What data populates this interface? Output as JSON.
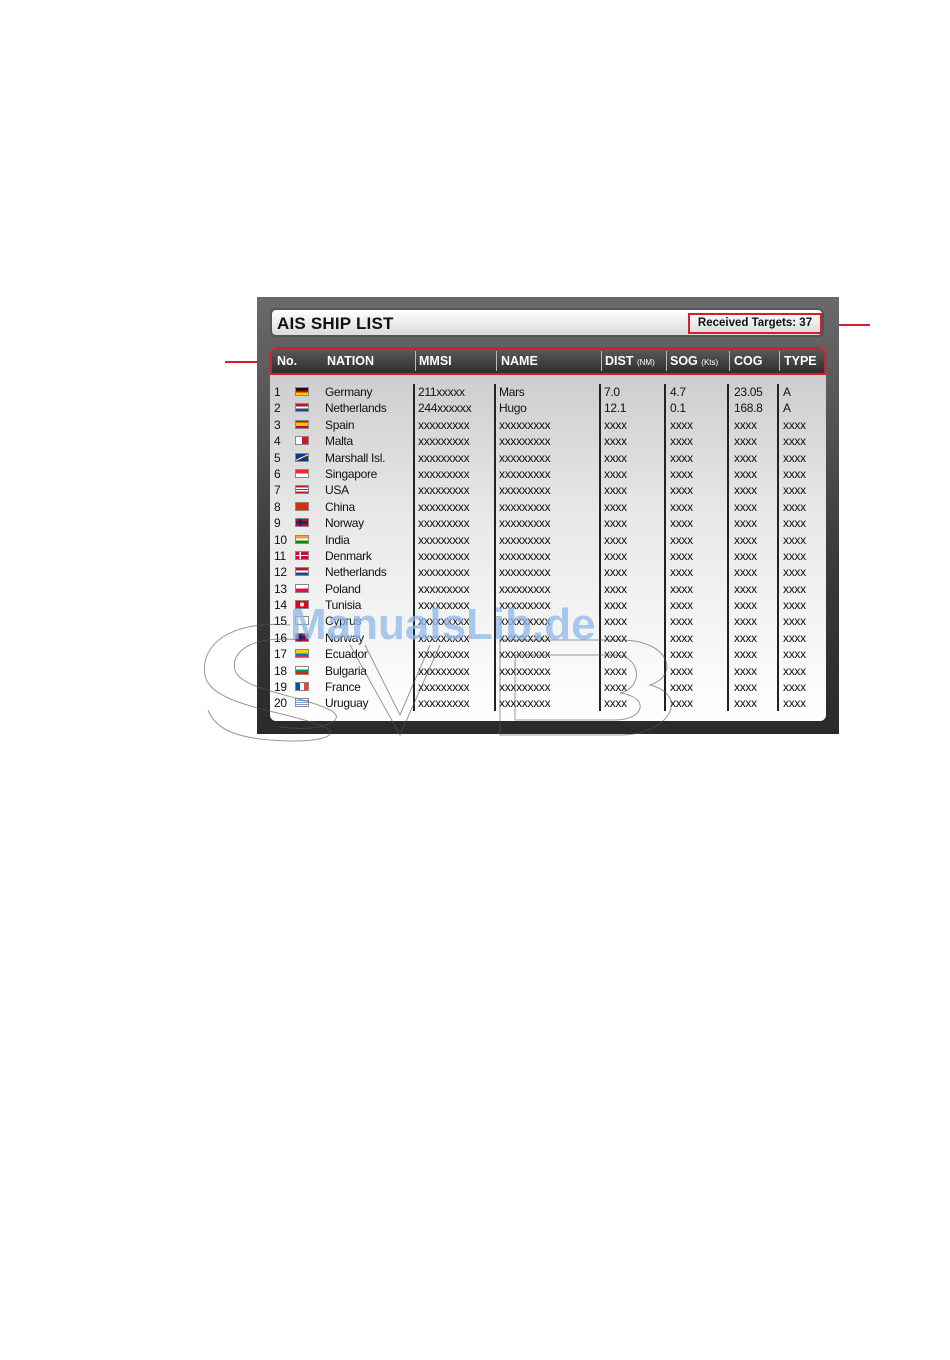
{
  "title": "AIS SHIP LIST",
  "received_targets": "Received Targets: 37",
  "columns": {
    "no": "No.",
    "nation": "NATION",
    "mmsi": "MMSI",
    "name": "NAME",
    "dist": "DIST",
    "dist_unit": "(NM)",
    "sog": "SOG",
    "sog_unit": "(Kts)",
    "cog": "COG",
    "type": "TYPE"
  },
  "rows": [
    {
      "no": "1",
      "nation": "Germany",
      "flag": "germany-flag-icon",
      "mmsi": "211xxxxx",
      "name": "Mars",
      "dist": "7.0",
      "sog": "4.7",
      "cog": "23.05",
      "type": "A"
    },
    {
      "no": "2",
      "nation": "Netherlands",
      "flag": "netherlands-flag-icon",
      "mmsi": "244xxxxxx",
      "name": "Hugo",
      "dist": "12.1",
      "sog": "0.1",
      "cog": "168.8",
      "type": "A"
    },
    {
      "no": "3",
      "nation": "Spain",
      "flag": "spain-flag-icon",
      "mmsi": "xxxxxxxxx",
      "name": "xxxxxxxxx",
      "dist": "xxxx",
      "sog": "xxxx",
      "cog": "xxxx",
      "type": "xxxx"
    },
    {
      "no": "4",
      "nation": "Malta",
      "flag": "malta-flag-icon",
      "mmsi": "xxxxxxxxx",
      "name": "xxxxxxxxx",
      "dist": "xxxx",
      "sog": "xxxx",
      "cog": "xxxx",
      "type": "xxxx"
    },
    {
      "no": "5",
      "nation": "Marshall Isl.",
      "flag": "marshall-islands-flag-icon",
      "mmsi": "xxxxxxxxx",
      "name": "xxxxxxxxx",
      "dist": "xxxx",
      "sog": "xxxx",
      "cog": "xxxx",
      "type": "xxxx"
    },
    {
      "no": "6",
      "nation": "Singapore",
      "flag": "singapore-flag-icon",
      "mmsi": "xxxxxxxxx",
      "name": "xxxxxxxxx",
      "dist": "xxxx",
      "sog": "xxxx",
      "cog": "xxxx",
      "type": "xxxx"
    },
    {
      "no": "7",
      "nation": "USA",
      "flag": "usa-flag-icon",
      "mmsi": "xxxxxxxxx",
      "name": "xxxxxxxxx",
      "dist": "xxxx",
      "sog": "xxxx",
      "cog": "xxxx",
      "type": "xxxx"
    },
    {
      "no": "8",
      "nation": "China",
      "flag": "china-flag-icon",
      "mmsi": "xxxxxxxxx",
      "name": "xxxxxxxxx",
      "dist": "xxxx",
      "sog": "xxxx",
      "cog": "xxxx",
      "type": "xxxx"
    },
    {
      "no": "9",
      "nation": "Norway",
      "flag": "norway-flag-icon",
      "mmsi": "xxxxxxxxx",
      "name": "xxxxxxxxx",
      "dist": "xxxx",
      "sog": "xxxx",
      "cog": "xxxx",
      "type": "xxxx"
    },
    {
      "no": "10",
      "nation": "India",
      "flag": "india-flag-icon",
      "mmsi": "xxxxxxxxx",
      "name": "xxxxxxxxx",
      "dist": "xxxx",
      "sog": "xxxx",
      "cog": "xxxx",
      "type": "xxxx"
    },
    {
      "no": "11",
      "nation": "Denmark",
      "flag": "denmark-flag-icon",
      "mmsi": "xxxxxxxxx",
      "name": "xxxxxxxxx",
      "dist": "xxxx",
      "sog": "xxxx",
      "cog": "xxxx",
      "type": "xxxx"
    },
    {
      "no": "12",
      "nation": "Netherlands",
      "flag": "netherlands-flag-icon",
      "mmsi": "xxxxxxxxx",
      "name": "xxxxxxxxx",
      "dist": "xxxx",
      "sog": "xxxx",
      "cog": "xxxx",
      "type": "xxxx"
    },
    {
      "no": "13",
      "nation": "Poland",
      "flag": "poland-flag-icon",
      "mmsi": "xxxxxxxxx",
      "name": "xxxxxxxxx",
      "dist": "xxxx",
      "sog": "xxxx",
      "cog": "xxxx",
      "type": "xxxx"
    },
    {
      "no": "14",
      "nation": "Tunisia",
      "flag": "tunisia-flag-icon",
      "mmsi": "xxxxxxxxx",
      "name": "xxxxxxxxx",
      "dist": "xxxx",
      "sog": "xxxx",
      "cog": "xxxx",
      "type": "xxxx"
    },
    {
      "no": "15",
      "nation": "Cyprus",
      "flag": "cyprus-flag-icon",
      "mmsi": "xxxxxxxxx",
      "name": "xxxxxxxxx",
      "dist": "xxxx",
      "sog": "xxxx",
      "cog": "xxxx",
      "type": "xxxx"
    },
    {
      "no": "16",
      "nation": "Norway",
      "flag": "norway-flag-icon",
      "mmsi": "xxxxxxxxx",
      "name": "xxxxxxxxx",
      "dist": "xxxx",
      "sog": "xxxx",
      "cog": "xxxx",
      "type": "xxxx"
    },
    {
      "no": "17",
      "nation": "Ecuador",
      "flag": "ecuador-flag-icon",
      "mmsi": "xxxxxxxxx",
      "name": "xxxxxxxxx",
      "dist": "xxxx",
      "sog": "xxxx",
      "cog": "xxxx",
      "type": "xxxx"
    },
    {
      "no": "18",
      "nation": "Bulgaria",
      "flag": "bulgaria-flag-icon",
      "mmsi": "xxxxxxxxx",
      "name": "xxxxxxxxx",
      "dist": "xxxx",
      "sog": "xxxx",
      "cog": "xxxx",
      "type": "xxxx"
    },
    {
      "no": "19",
      "nation": "France",
      "flag": "france-flag-icon",
      "mmsi": "xxxxxxxxx",
      "name": "xxxxxxxxx",
      "dist": "xxxx",
      "sog": "xxxx",
      "cog": "xxxx",
      "type": "xxxx"
    },
    {
      "no": "20",
      "nation": "Uruguay",
      "flag": "uruguay-flag-icon",
      "mmsi": "xxxxxxxxx",
      "name": "xxxxxxxxx",
      "dist": "xxxx",
      "sog": "xxxx",
      "cog": "xxxx",
      "type": "xxxx"
    }
  ],
  "watermark": "ManualsLib.de",
  "colors": {
    "callout_red": "#d1202a",
    "header_bg": "#3a3a3a",
    "watermark_blue": "#8fb8ea"
  }
}
